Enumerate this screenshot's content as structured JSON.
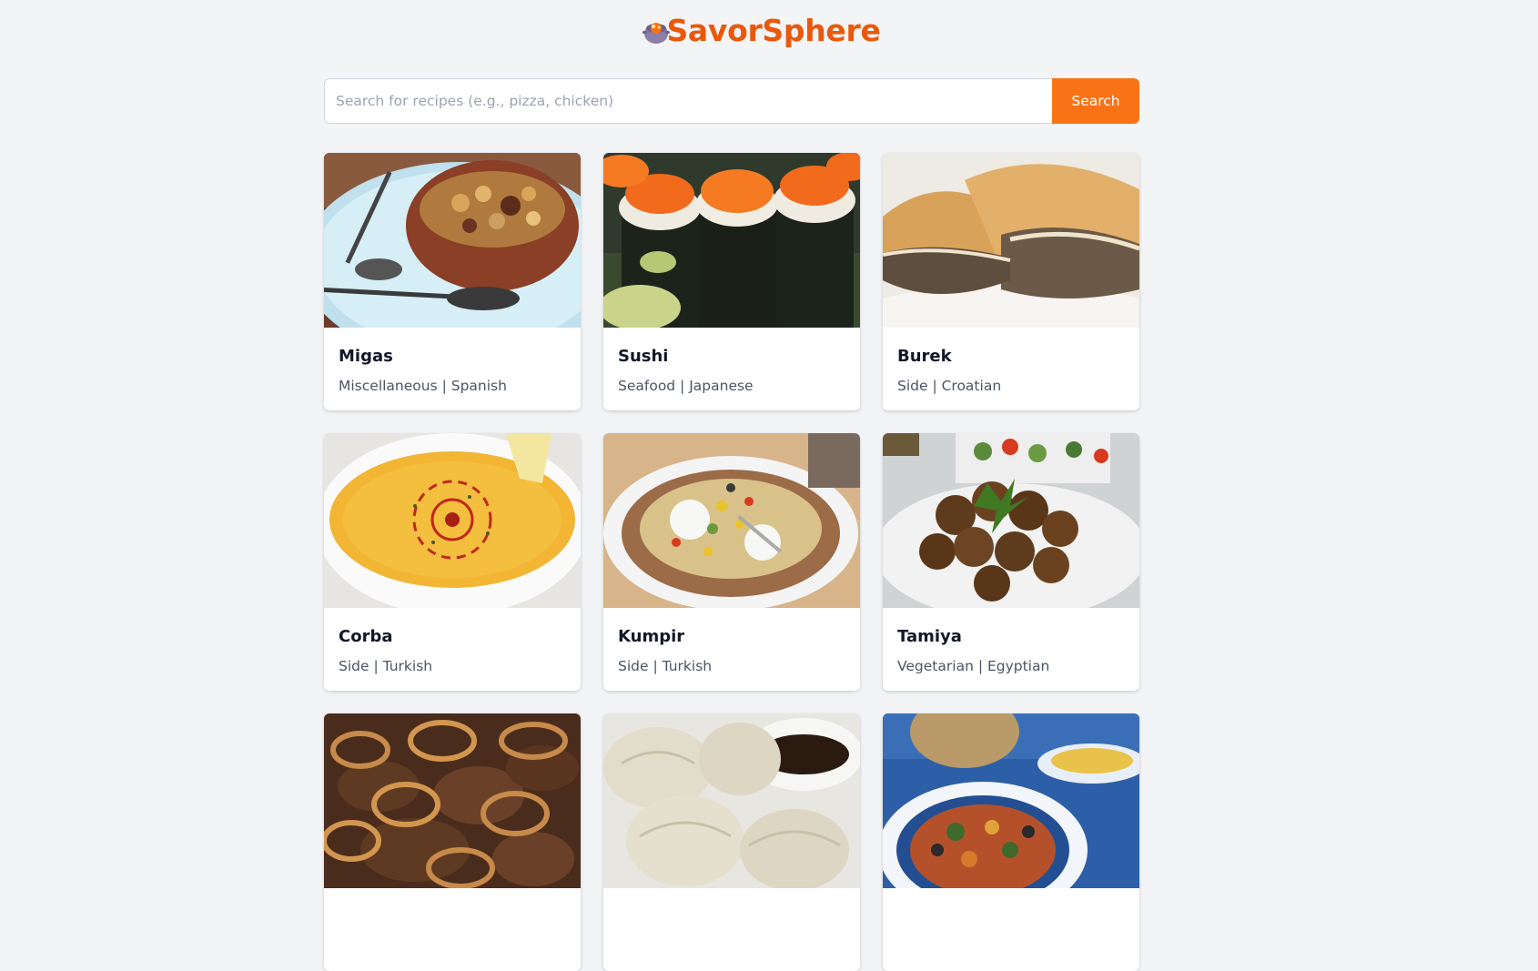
{
  "app": {
    "title": "SavorSphere",
    "logo_icon": "cooking-pot-icon",
    "accent": "#ea580c",
    "button_color": "#f97316"
  },
  "search": {
    "placeholder": "Search for recipes (e.g., pizza, chicken)",
    "value": "",
    "button_label": "Search"
  },
  "recipes": [
    {
      "name": "Migas",
      "meta": "Miscellaneous | Spanish",
      "image": "migas-photo"
    },
    {
      "name": "Sushi",
      "meta": "Seafood | Japanese",
      "image": "sushi-photo"
    },
    {
      "name": "Burek",
      "meta": "Side | Croatian",
      "image": "burek-photo"
    },
    {
      "name": "Corba",
      "meta": "Side | Turkish",
      "image": "corba-photo"
    },
    {
      "name": "Kumpir",
      "meta": "Side | Turkish",
      "image": "kumpir-photo"
    },
    {
      "name": "Tamiya",
      "meta": "Vegetarian | Egyptian",
      "image": "tamiya-photo"
    },
    {
      "name": "",
      "meta": "",
      "image": "beef-onion-photo"
    },
    {
      "name": "",
      "meta": "",
      "image": "dumplings-photo"
    },
    {
      "name": "",
      "meta": "",
      "image": "stew-plate-photo"
    }
  ]
}
